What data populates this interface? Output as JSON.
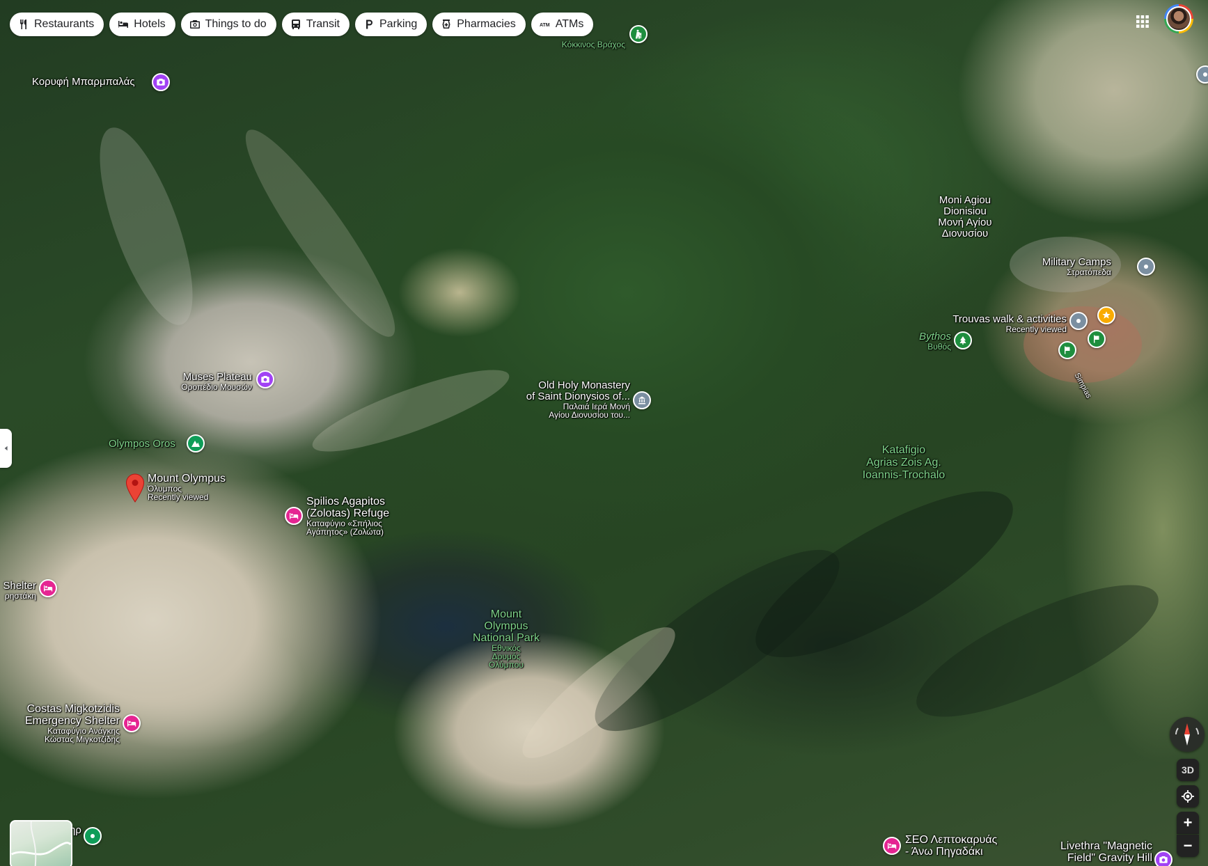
{
  "chips": [
    {
      "label": "Restaurants",
      "icon": "fork-knife-icon"
    },
    {
      "label": "Hotels",
      "icon": "bed-icon"
    },
    {
      "label": "Things to do",
      "icon": "camera-icon"
    },
    {
      "label": "Transit",
      "icon": "bus-icon"
    },
    {
      "label": "Parking",
      "icon": "parking-icon"
    },
    {
      "label": "Pharmacies",
      "icon": "pharmacy-icon"
    },
    {
      "label": "ATMs",
      "icon": "atm-icon"
    }
  ],
  "places": {
    "kokkinos_vrachos": {
      "name": "",
      "sub": "Κόκκινος Βράχος"
    },
    "koryfi": {
      "name": "Κορυφή Μπαρμπαλάς"
    },
    "moni_agiou": {
      "line1": "Moni Agiou",
      "line2": "Dionisiou",
      "line3": "Μονή Αγίου",
      "line4": "Διονυσίου"
    },
    "military_camps": {
      "name": "Military Camps",
      "sub": "Στρατόπεδα"
    },
    "trouvas": {
      "name": "Trouvas walk & activities",
      "sub": "Recently viewed"
    },
    "bythos": {
      "name": "Bythos",
      "sub": "Βυθός"
    },
    "muses_plateau": {
      "name": "Muses Plateau",
      "sub": "Οροπέδιο Μουσών"
    },
    "old_holy_monastery": {
      "line1": "Old Holy Monastery",
      "line2": "of Saint Dionysios of...",
      "line3": "Παλαιά Ιερά Μονή",
      "line4": "Αγίου Διονυσίου του..."
    },
    "olympos_oros": {
      "name": "Olympos Oros"
    },
    "mount_olympus": {
      "name": "Mount Olympus",
      "sub1": "Όλυμπος",
      "sub2": "Recently viewed"
    },
    "spilios": {
      "line1": "Spilios Agapitos",
      "line2": "(Zolotas) Refuge",
      "line3": "Καταφύγιο «Σπήλιος",
      "line4": "Αγάπητος» (Ζολώτα)"
    },
    "katafigio": {
      "line1": "Katafigio",
      "line2": "Agrias Zois Ag.",
      "line3": "Ioannis-Trochalo"
    },
    "shelter": {
      "name": "Shelter",
      "sub": "ρηστάκη"
    },
    "national_park": {
      "line1": "Mount",
      "line2": "Olympus",
      "line3": "National Park",
      "line4": "Εθνικός",
      "line5": "Δρυμός",
      "line6": "Ολύμπου"
    },
    "costas": {
      "line1": "Costas Migkotzidis",
      "line2": "Emergency Shelter",
      "line3": "Καταφύγιο Ανάγκης",
      "line4": "Κώστας Μιγκοτζίδης"
    },
    "seo": {
      "line1": "ΣΕΟ Λεπτοκαρυάς",
      "line2": "- Άνω Πηγαδάκι"
    },
    "livethra": {
      "line1": "Livethra \"Magnetic",
      "line2": "Field\" Gravity Hill"
    },
    "simpias": {
      "name": "Simpias"
    },
    "bottom_left_partial": {
      "name": "ηρ"
    }
  },
  "controls": {
    "three_d": "3D",
    "zoom_in": "+",
    "zoom_out": "−"
  },
  "colors": {
    "chip_bg": "#ffffff",
    "selected_pin": "#ea4335",
    "attraction_pin": "#a142f4",
    "lodging_pin": "#e52592",
    "park_label": "#7fd48b"
  }
}
